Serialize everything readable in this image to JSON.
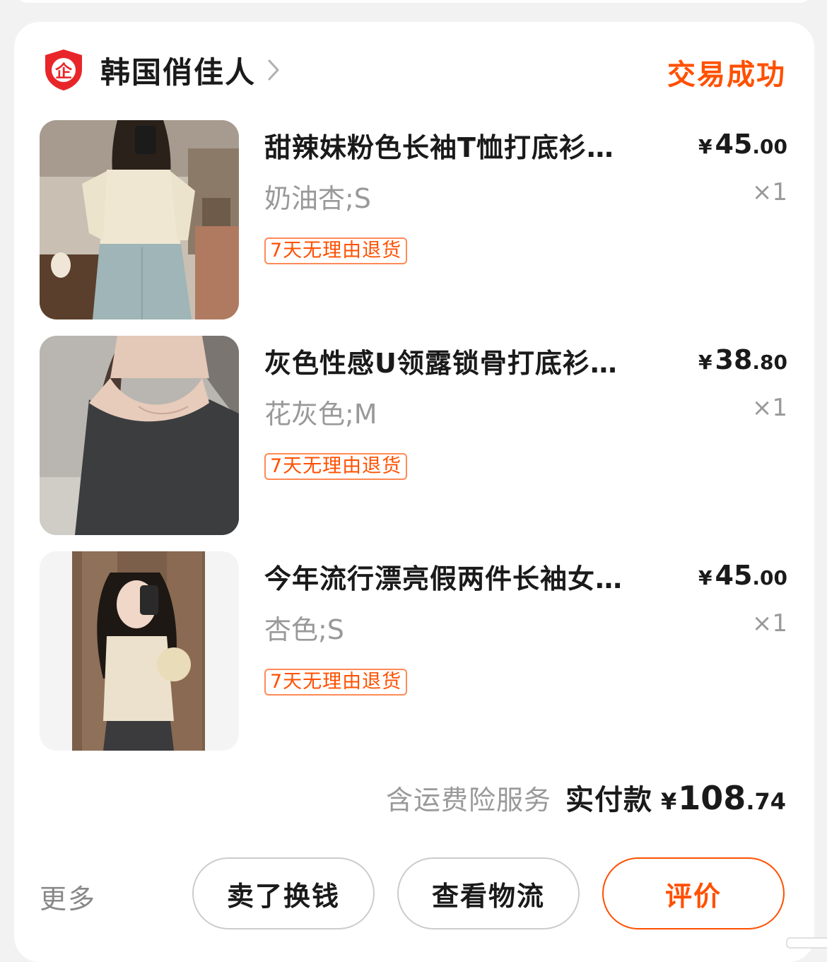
{
  "shop": {
    "name": "韩国俏佳人",
    "badge_icon": "enterprise-shield-icon",
    "badge_glyph": "企",
    "status": "交易成功",
    "status_color": "#ff5000"
  },
  "items": [
    {
      "title": "甜辣妹粉色长袖T恤打底衫…",
      "price_currency": "¥",
      "price_int": "45",
      "price_dec": ".00",
      "sku": "奶油杏;S",
      "qty": "×1",
      "tag": "7天无理由退货"
    },
    {
      "title": "灰色性感U领露锁骨打底衫…",
      "price_currency": "¥",
      "price_int": "38",
      "price_dec": ".80",
      "sku": "花灰色;M",
      "qty": "×1",
      "tag": "7天无理由退货"
    },
    {
      "title": "今年流行漂亮假两件长袖女…",
      "price_currency": "¥",
      "price_int": "45",
      "price_dec": ".00",
      "sku": "杏色;S",
      "qty": "×1",
      "tag": "7天无理由退货"
    }
  ],
  "total": {
    "service": "含运费险服务",
    "paid_label": "实付款",
    "currency": "¥",
    "int": "108",
    "dec": ".74"
  },
  "actions": {
    "more": "更多",
    "sell": "卖了换钱",
    "logistics": "查看物流",
    "review": "评价"
  },
  "colors": {
    "accent": "#ff5000",
    "badge_red": "#e8262a",
    "text_primary": "#1a1a1a",
    "text_secondary": "#999999"
  }
}
